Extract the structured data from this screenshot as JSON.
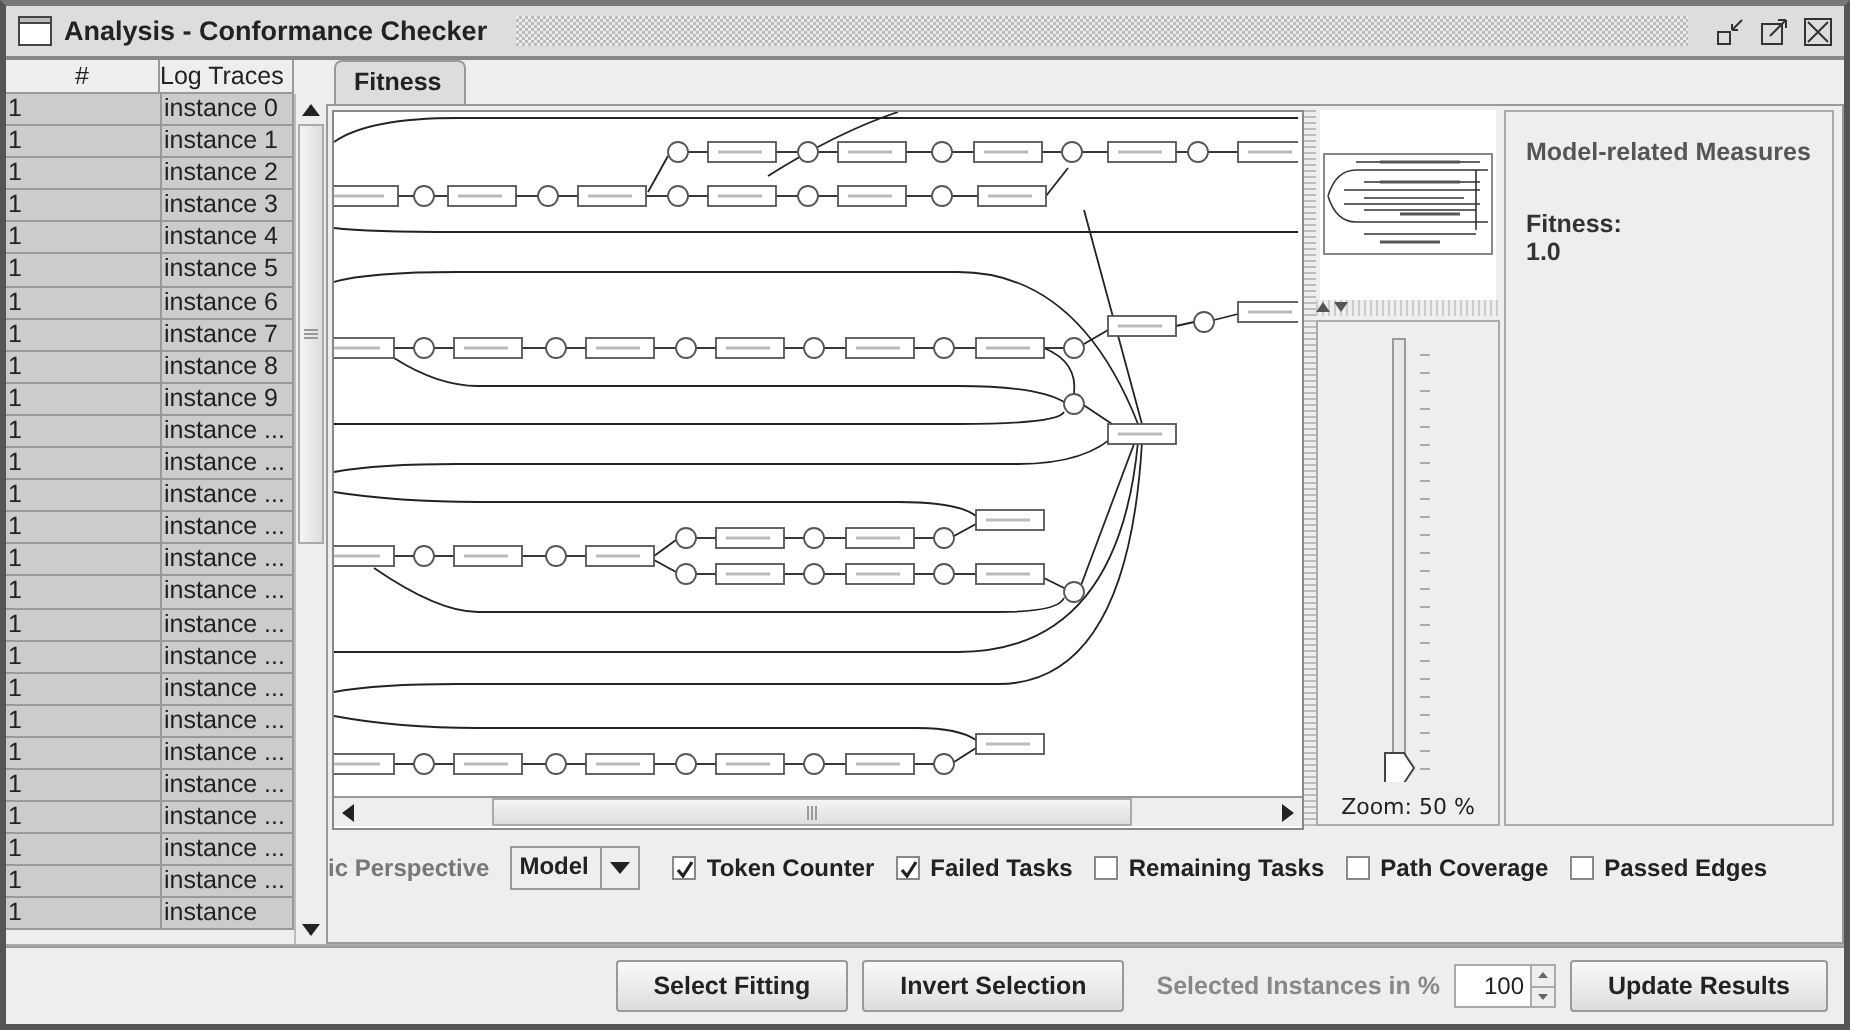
{
  "window": {
    "title": "Analysis - Conformance Checker"
  },
  "trace_table": {
    "columns": [
      "#",
      "Log Traces"
    ],
    "rows": [
      {
        "count": "1",
        "trace": "instance 0"
      },
      {
        "count": "1",
        "trace": "instance 1"
      },
      {
        "count": "1",
        "trace": "instance 2"
      },
      {
        "count": "1",
        "trace": "instance 3"
      },
      {
        "count": "1",
        "trace": "instance 4"
      },
      {
        "count": "1",
        "trace": "instance 5"
      },
      {
        "count": "1",
        "trace": "instance 6"
      },
      {
        "count": "1",
        "trace": "instance 7"
      },
      {
        "count": "1",
        "trace": "instance 8"
      },
      {
        "count": "1",
        "trace": "instance 9"
      },
      {
        "count": "1",
        "trace": "instance ..."
      },
      {
        "count": "1",
        "trace": "instance ..."
      },
      {
        "count": "1",
        "trace": "instance ..."
      },
      {
        "count": "1",
        "trace": "instance ..."
      },
      {
        "count": "1",
        "trace": "instance ..."
      },
      {
        "count": "1",
        "trace": "instance ..."
      },
      {
        "count": "1",
        "trace": "instance ..."
      },
      {
        "count": "1",
        "trace": "instance ..."
      },
      {
        "count": "1",
        "trace": "instance ..."
      },
      {
        "count": "1",
        "trace": "instance ..."
      },
      {
        "count": "1",
        "trace": "instance ..."
      },
      {
        "count": "1",
        "trace": "instance ..."
      },
      {
        "count": "1",
        "trace": "instance ..."
      },
      {
        "count": "1",
        "trace": "instance ..."
      },
      {
        "count": "1",
        "trace": "instance ..."
      },
      {
        "count": "1",
        "trace": "instance"
      }
    ]
  },
  "tabs": [
    {
      "label": "Fitness",
      "selected": true
    }
  ],
  "zoom": {
    "level": 0.02,
    "reading": "Zoom: 50 %"
  },
  "measures": {
    "heading": "Model-related Measures",
    "items": [
      {
        "label": "Fitness:",
        "value": "1.0"
      }
    ]
  },
  "options": {
    "perspective_label": "ic Perspective",
    "perspective": "Model",
    "checkboxes": [
      {
        "label": "Token Counter",
        "checked": true
      },
      {
        "label": "Failed Tasks",
        "checked": true
      },
      {
        "label": "Remaining Tasks",
        "checked": false
      },
      {
        "label": "Path Coverage",
        "checked": false
      },
      {
        "label": "Passed Edges",
        "checked": false
      }
    ]
  },
  "bottom_bar": {
    "buttons": [
      "Select Fitting",
      "Invert Selection"
    ],
    "instances_label": "Selected Instances in %",
    "instances_value": "100",
    "update_button": "Update Results"
  }
}
